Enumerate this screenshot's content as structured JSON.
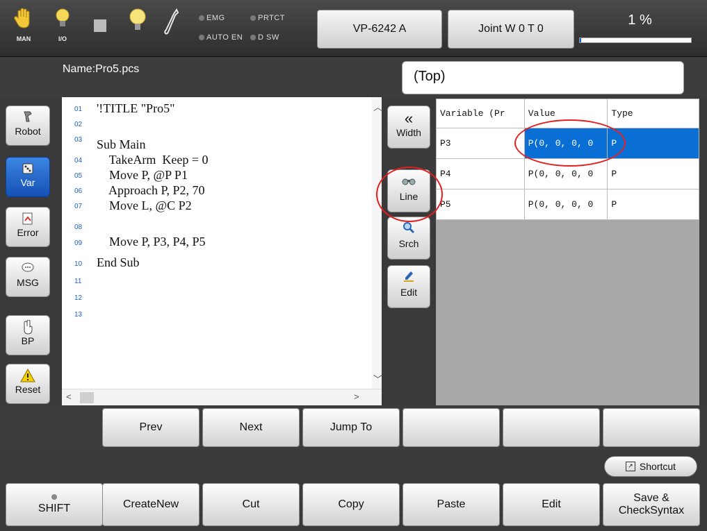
{
  "topbar": {
    "man_label": "MAN",
    "io_label": "I/O",
    "lamps": {
      "emg": "EMG",
      "prtct": "PRTCT",
      "auto_en": "AUTO EN",
      "dsw": "D SW"
    },
    "robot_model": "VP-6242 A",
    "mode": "Joint W 0 T 0",
    "speed": "1 %",
    "speed_fraction": 0.01
  },
  "file": {
    "name": "Name:Pro5.pcs",
    "position": "(Top)"
  },
  "side_buttons": [
    "Robot",
    "Var",
    "Error",
    "MSG",
    "BP",
    "Reset"
  ],
  "editor": {
    "line_numbers": [
      "01",
      "02",
      "03",
      "04",
      "05",
      "06",
      "07",
      "08",
      "09",
      "10",
      "11",
      "12",
      "13"
    ],
    "lines": [
      "'!TITLE \"Pro5\"",
      "",
      "Sub Main",
      "    TakeArm  Keep = 0",
      "    Move P, @P P1",
      "    Approach P, P2, 70",
      "    Move L, @C P2",
      "",
      "    Move P, P3, P4, P5",
      "End Sub",
      "",
      "",
      ""
    ]
  },
  "tool_buttons": {
    "width": "Width",
    "line": "Line",
    "search": "Srch",
    "edit": "Edit"
  },
  "var_table": {
    "headers": [
      "Variable (Pr",
      "Value",
      "Type"
    ],
    "rows": [
      {
        "name": "P3",
        "value": "P(0, 0, 0, 0",
        "type": "P"
      },
      {
        "name": "P4",
        "value": "P(0, 0, 0, 0",
        "type": "P"
      },
      {
        "name": "P5",
        "value": "P(0, 0, 0, 0",
        "type": "P"
      }
    ]
  },
  "nav_buttons": [
    "Prev",
    "Next",
    "Jump To",
    "",
    "",
    ""
  ],
  "shortcut_label": "Shortcut",
  "func_buttons": {
    "shift": "SHIFT",
    "create_new": "CreateNew",
    "cut": "Cut",
    "copy": "Copy",
    "paste": "Paste",
    "edit": "Edit",
    "save_line1": "Save &",
    "save_line2": "CheckSyntax"
  },
  "colors": {
    "accent_blue": "#0a6fd4",
    "annotation_red": "#e41f1f",
    "code_keyword": "#1a2ec8",
    "code_literal": "#0a9a1a",
    "line_number": "#1b63c9"
  }
}
